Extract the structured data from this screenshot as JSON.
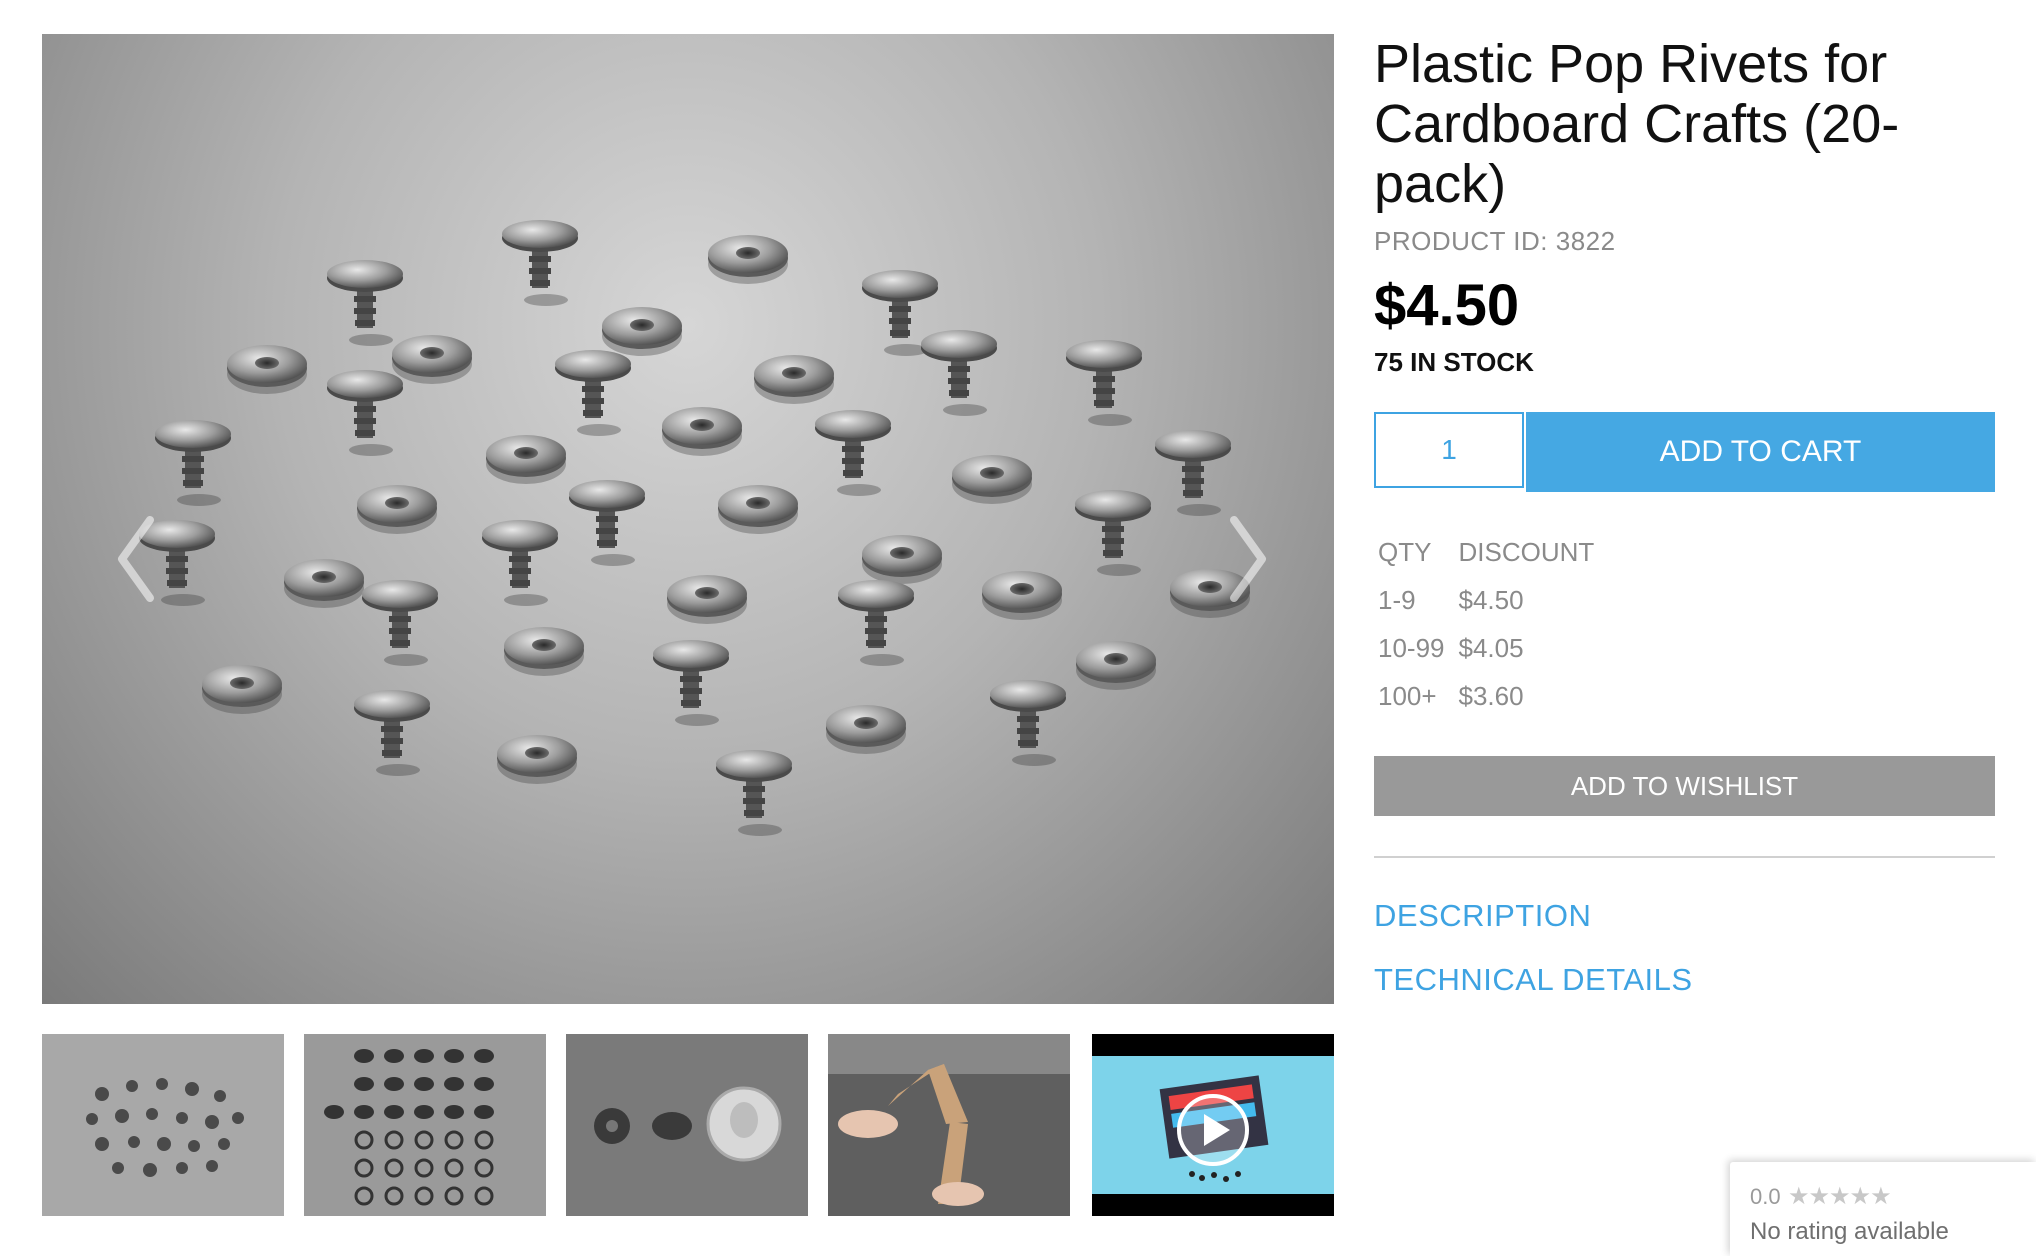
{
  "product": {
    "title": "Plastic Pop Rivets for Cardboard Crafts (20-pack)",
    "product_id": "PRODUCT ID: 3822",
    "price": "$4.50",
    "stock": "75 IN STOCK"
  },
  "cart": {
    "quantity": "1",
    "add_to_cart_label": "ADD TO CART",
    "add_to_wishlist_label": "ADD TO WISHLIST"
  },
  "discounts": {
    "headers": [
      "QTY",
      "DISCOUNT"
    ],
    "rows": [
      {
        "qty": "1-9",
        "price": "$4.50"
      },
      {
        "qty": "10-99",
        "price": "$4.05"
      },
      {
        "qty": "100+",
        "price": "$3.60"
      }
    ]
  },
  "tabs": {
    "description": "DESCRIPTION",
    "technical_details": "TECHNICAL DETAILS"
  },
  "gallery": {
    "arrows": [
      "chevron-left-icon",
      "chevron-right-icon"
    ],
    "thumbnails": [
      "rivets-scattered",
      "rivets-rows",
      "rivet-with-quarter-coin",
      "cardboard-arm-hands",
      "video-led-matrix"
    ]
  },
  "rating": {
    "score": "0.0",
    "stars": "★★★★★",
    "label": "No rating available"
  },
  "colors": {
    "accent": "#45a8e3",
    "wishlist_button": "#999999",
    "muted_text": "#8a8a8a"
  }
}
